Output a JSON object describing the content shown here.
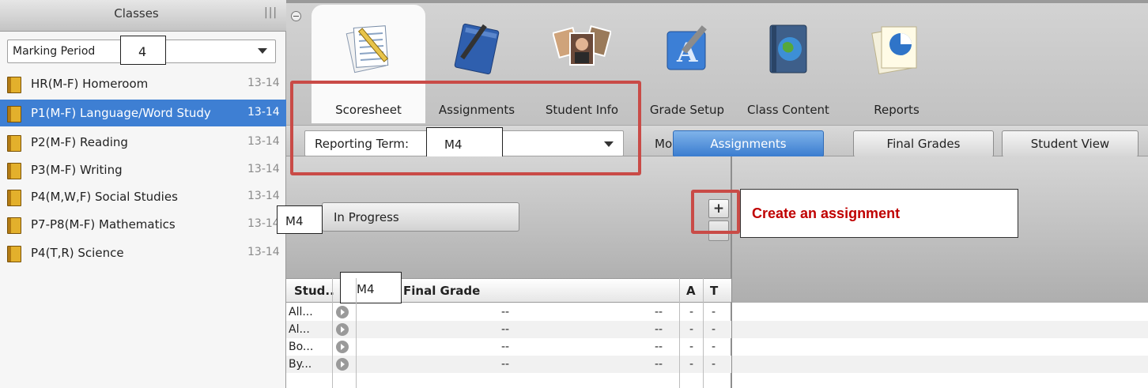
{
  "sidebar": {
    "title": "Classes",
    "grip": "|||",
    "marking_period": {
      "label": "Marking Period",
      "value": "4"
    },
    "classes": [
      {
        "name": "HR(M-F) Homeroom",
        "year": "13-14"
      },
      {
        "name": "P1(M-F) Language/Word Study",
        "year": "13-14"
      },
      {
        "name": "P2(M-F) Reading",
        "year": "13-14"
      },
      {
        "name": "P3(M-F) Writing",
        "year": "13-14"
      },
      {
        "name": "P4(M,W,F) Social Studies",
        "year": "13-14"
      },
      {
        "name": "P7-P8(M-F) Mathematics",
        "year": "13-14"
      },
      {
        "name": "P4(T,R) Science",
        "year": "13-14"
      }
    ],
    "selected_index": 1
  },
  "toolbar": {
    "tools": [
      {
        "label": "Scoresheet",
        "icon": "scoresheet-icon",
        "active": true
      },
      {
        "label": "Assignments",
        "icon": "assignments-notebook-icon",
        "active": false
      },
      {
        "label": "Student Info",
        "icon": "student-photos-icon",
        "active": false
      },
      {
        "label": "Grade Setup",
        "icon": "grade-setup-icon",
        "active": false
      },
      {
        "label": "Class Content",
        "icon": "class-content-globe-icon",
        "active": false
      },
      {
        "label": "Reports",
        "icon": "reports-pie-icon",
        "active": false
      }
    ]
  },
  "reporting_term": {
    "label": "Reporting Term:",
    "value": "M4"
  },
  "mode": {
    "label": "Mode:",
    "buttons": [
      {
        "label": "Assignments",
        "active": true
      },
      {
        "label": "Final Grades",
        "active": false
      },
      {
        "label": "Student View",
        "active": false
      }
    ]
  },
  "status_filter": {
    "term": "M4",
    "label": "In Progress"
  },
  "add_assignment": {
    "symbol": "+",
    "callout": "Create an assignment"
  },
  "grid": {
    "overlay_term": "M4",
    "headers": {
      "student": "Stud..",
      "final_grade": "Final Grade",
      "a": "A",
      "t": "T"
    },
    "rows": [
      {
        "name": "All...",
        "final": "--",
        "grade2": "--",
        "a": "-",
        "t": "-"
      },
      {
        "name": "Al...",
        "final": "--",
        "grade2": "--",
        "a": "-",
        "t": "-"
      },
      {
        "name": "Bo...",
        "final": "--",
        "grade2": "--",
        "a": "-",
        "t": "-"
      },
      {
        "name": "By...",
        "final": "--",
        "grade2": "--",
        "a": "-",
        "t": "-"
      }
    ]
  },
  "colors": {
    "selection_blue": "#3e7fd3",
    "highlight_red": "#c94b47",
    "callout_red": "#c00000"
  }
}
